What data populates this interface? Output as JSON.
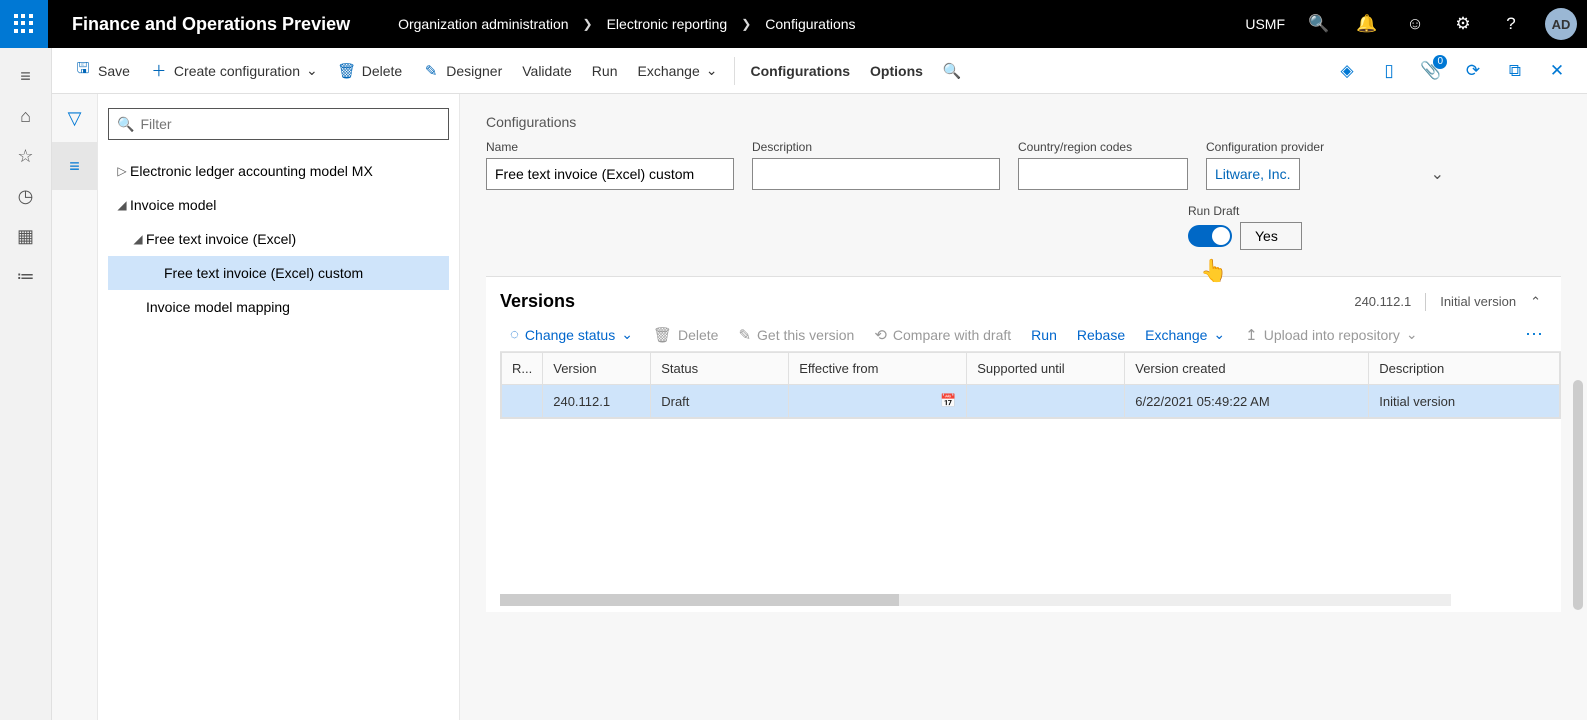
{
  "header": {
    "app_title": "Finance and Operations Preview",
    "breadcrumb": [
      "Organization administration",
      "Electronic reporting",
      "Configurations"
    ],
    "company": "USMF",
    "avatar": "AD"
  },
  "commandbar": {
    "save": "Save",
    "create_config": "Create configuration",
    "delete": "Delete",
    "designer": "Designer",
    "validate": "Validate",
    "run": "Run",
    "exchange": "Exchange",
    "configurations": "Configurations",
    "options": "Options",
    "notifications_count": "0"
  },
  "tree": {
    "filter_placeholder": "Filter",
    "items": [
      {
        "label": "Electronic ledger accounting model MX",
        "expand": "▷",
        "indent": 0
      },
      {
        "label": "Invoice model",
        "expand": "◢",
        "indent": 0
      },
      {
        "label": "Free text invoice (Excel)",
        "expand": "◢",
        "indent": 1
      },
      {
        "label": "Free text invoice (Excel) custom",
        "expand": "",
        "indent": 2,
        "selected": true
      },
      {
        "label": "Invoice model mapping",
        "expand": "",
        "indent": 1
      }
    ]
  },
  "form": {
    "section_title": "Configurations",
    "name_label": "Name",
    "name_value": "Free text invoice (Excel) custom",
    "desc_label": "Description",
    "desc_value": "",
    "cc_label": "Country/region codes",
    "cc_value": "",
    "prov_label": "Configuration provider",
    "prov_value": "Litware, Inc.",
    "run_draft_label": "Run Draft",
    "run_draft_value": "Yes"
  },
  "versions": {
    "title": "Versions",
    "summary_version": "240.112.1",
    "summary_desc": "Initial version",
    "cmds": {
      "change_status": "Change status",
      "delete": "Delete",
      "get_this_version": "Get this version",
      "compare": "Compare with draft",
      "run": "Run",
      "rebase": "Rebase",
      "exchange": "Exchange",
      "upload": "Upload into repository"
    },
    "columns": {
      "r": "R...",
      "version": "Version",
      "status": "Status",
      "effective": "Effective from",
      "supported": "Supported until",
      "created": "Version created",
      "description": "Description"
    },
    "rows": [
      {
        "version": "240.112.1",
        "status": "Draft",
        "effective": "",
        "supported": "",
        "created": "6/22/2021 05:49:22 AM",
        "description": "Initial version"
      }
    ]
  }
}
